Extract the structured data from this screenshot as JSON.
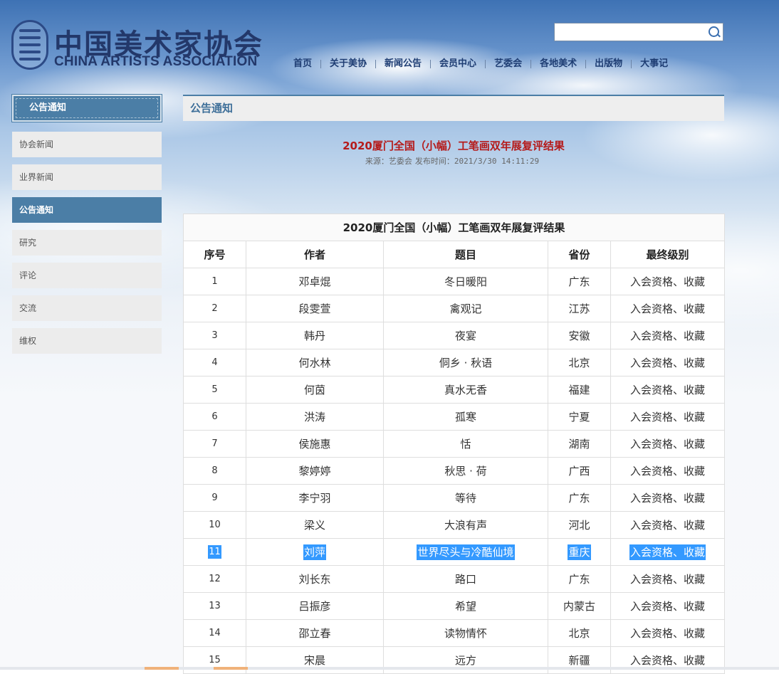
{
  "header": {
    "logo_cn": "中国美术家协会",
    "logo_en": "CHINA ARTISTS ASSOCIATION",
    "search_value": "",
    "nav": [
      "首页",
      "关于美协",
      "新闻公告",
      "会员中心",
      "艺委会",
      "各地美术",
      "出版物",
      "大事记"
    ]
  },
  "sidebar": {
    "title": "公告通知",
    "items": [
      {
        "label": "协会新闻",
        "active": false
      },
      {
        "label": "业界新闻",
        "active": false
      },
      {
        "label": "公告通知",
        "active": true
      },
      {
        "label": "研究",
        "active": false
      },
      {
        "label": "评论",
        "active": false
      },
      {
        "label": "交流",
        "active": false
      },
      {
        "label": "维权",
        "active": false
      }
    ]
  },
  "main": {
    "section_title": "公告通知",
    "article_title": "2020厦门全国（小幅）工笔画双年展复评结果",
    "source": "来源：艺委会",
    "published": "发布时间：2021/3/30 14:11:29",
    "table": {
      "caption": "2020厦门全国（小幅）工笔画双年展复评结果",
      "headers": [
        "序号",
        "作者",
        "题目",
        "省份",
        "最终级别"
      ],
      "rows": [
        [
          "1",
          "邓卓焜",
          "冬日暖阳",
          "广东",
          "入会资格、收藏"
        ],
        [
          "2",
          "段雯萱",
          "禽观记",
          "江苏",
          "入会资格、收藏"
        ],
        [
          "3",
          "韩丹",
          "夜宴",
          "安徽",
          "入会资格、收藏"
        ],
        [
          "4",
          "何水林",
          "侗乡 · 秋语",
          "北京",
          "入会资格、收藏"
        ],
        [
          "5",
          "何茵",
          "真水无香",
          "福建",
          "入会资格、收藏"
        ],
        [
          "6",
          "洪涛",
          "孤寒",
          "宁夏",
          "入会资格、收藏"
        ],
        [
          "7",
          "侯施惠",
          "恬",
          "湖南",
          "入会资格、收藏"
        ],
        [
          "8",
          "黎婷婷",
          "秋思 · 荷",
          "广西",
          "入会资格、收藏"
        ],
        [
          "9",
          "李宁羽",
          "等待",
          "广东",
          "入会资格、收藏"
        ],
        [
          "10",
          "梁义",
          "大浪有声",
          "河北",
          "入会资格、收藏"
        ],
        [
          "11",
          "刘萍",
          "世界尽头与冷酷仙境",
          "重庆",
          "入会资格、收藏"
        ],
        [
          "12",
          "刘长东",
          "路口",
          "广东",
          "入会资格、收藏"
        ],
        [
          "13",
          "吕振彦",
          "希望",
          "内蒙古",
          "入会资格、收藏"
        ],
        [
          "14",
          "邵立春",
          "读物情怀",
          "北京",
          "入会资格、收藏"
        ],
        [
          "15",
          "宋晨",
          "远方",
          "新疆",
          "入会资格、收藏"
        ]
      ],
      "selected_row": 10
    }
  },
  "colors": {
    "accent": "#4b7ea6",
    "title_red": "#b51b1b",
    "selection": "#3399ff"
  }
}
